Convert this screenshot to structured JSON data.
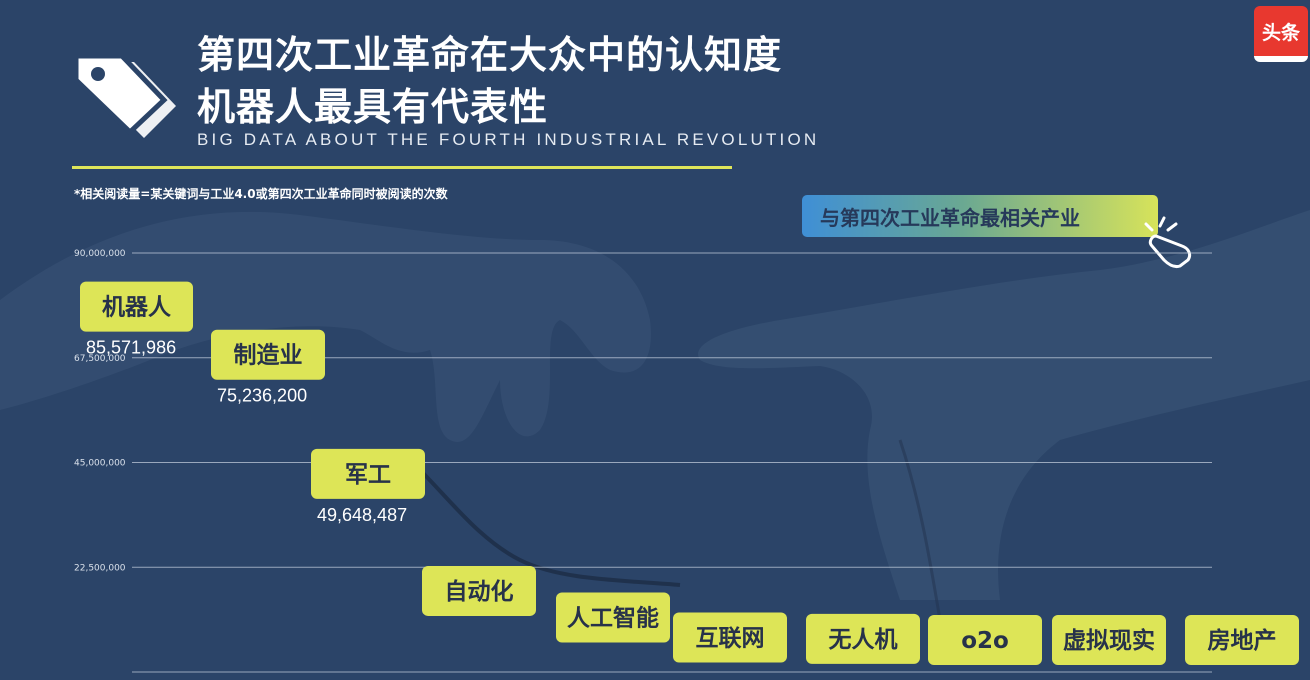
{
  "header": {
    "title_line1": "第四次工业革命在大众中的认知度",
    "title_line2": "机器人最具有代表性",
    "subtitle": "BIG DATA ABOUT THE FOURTH INDUSTRIAL REVOLUTION",
    "footnote": "*相关阅读量=某关键词与工业4.0或第四次工业革命同时被阅读的次数",
    "callout": "与第四次工业革命最相关产业",
    "logo_text": "头条"
  },
  "colors": {
    "background": "#2b4468",
    "accent": "#dde557",
    "label_text": "#27324a"
  },
  "icons": [
    "tag-icon",
    "pointing-hand-icon"
  ],
  "chart_data": {
    "type": "bar",
    "title": "第四次工业革命在大众中的认知度",
    "ylim": [
      0,
      90000000
    ],
    "yticks": [
      "90,000,000",
      "67,500,000",
      "45,000,000",
      "22,500,000"
    ],
    "ytick_values": [
      90000000,
      67500000,
      45000000,
      22500000
    ],
    "grid": true,
    "categories": [
      "机器人",
      "制造业",
      "军工",
      "自动化",
      "人工智能",
      "互联网",
      "无人机",
      "o2o",
      "虚拟现实",
      "房地产"
    ],
    "values": [
      85571986,
      75236200,
      49648487,
      24500000,
      18800000,
      14500000,
      14200000,
      12500000,
      11800000,
      8200000
    ],
    "value_labels": [
      "85,571,986",
      "75,236,200",
      "49,648,487",
      "",
      "",
      "",
      "",
      "",
      "",
      ""
    ]
  }
}
